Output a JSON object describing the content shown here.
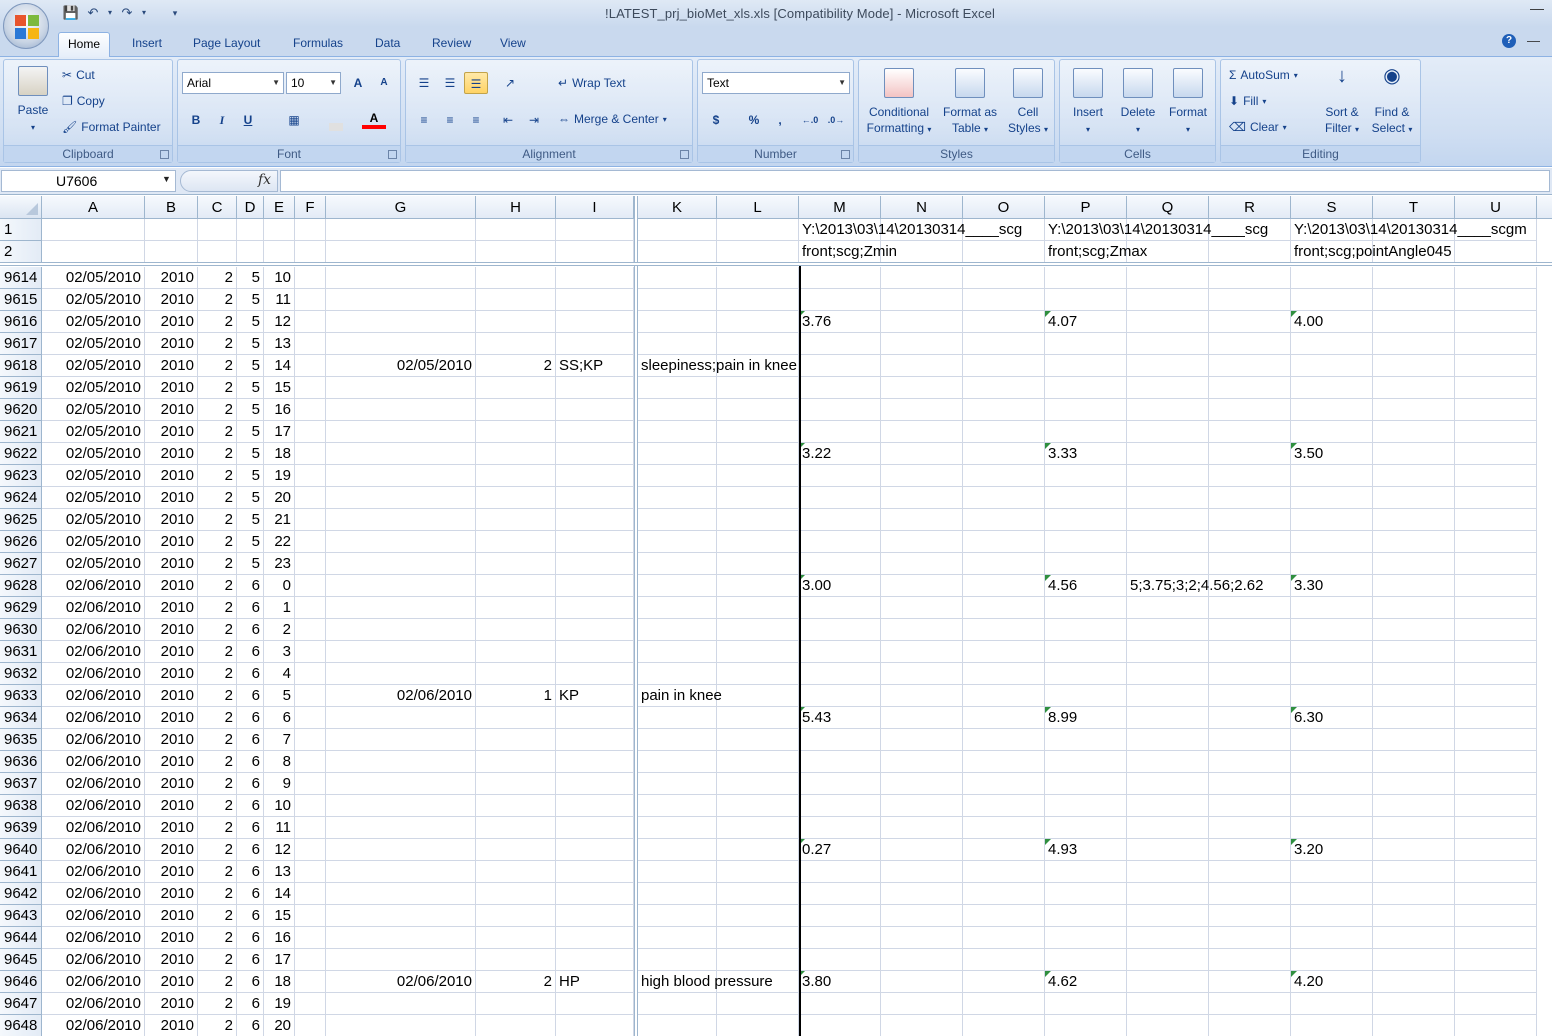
{
  "window": {
    "title": "!LATEST_prj_bioMet_xls.xls  [Compatibility Mode] - Microsoft Excel"
  },
  "tabs": [
    "Home",
    "Insert",
    "Page Layout",
    "Formulas",
    "Data",
    "Review",
    "View"
  ],
  "active_tab": "Home",
  "clipboard": {
    "paste": "Paste",
    "cut": "Cut",
    "copy": "Copy",
    "format_painter": "Format Painter",
    "label": "Clipboard"
  },
  "font": {
    "name": "Arial",
    "size": "10",
    "label": "Font",
    "bold": "B",
    "italic": "I",
    "underline": "U",
    "grow": "A",
    "shrink": "A",
    "font_color": "A",
    "fill_color": "#ffff00",
    "text_color": "#ff0000"
  },
  "alignment": {
    "wrap_text": "Wrap Text",
    "merge_center": "Merge & Center",
    "label": "Alignment"
  },
  "number": {
    "format": "Text",
    "currency": "$",
    "percent": "%",
    "comma": ",",
    "label": "Number"
  },
  "styles": {
    "conditional": "Conditional",
    "formatting": "Formatting",
    "format_as": "Format as",
    "table": "Table",
    "cell": "Cell",
    "cell_styles": "Styles",
    "label": "Styles"
  },
  "cells": {
    "insert": "Insert",
    "delete": "Delete",
    "format": "Format",
    "label": "Cells"
  },
  "editing": {
    "autosum": "AutoSum",
    "fill": "Fill",
    "clear": "Clear",
    "sort1": "Sort &",
    "sort2": "Filter",
    "find1": "Find &",
    "find2": "Select",
    "label": "Editing"
  },
  "formula_bar": {
    "name_box": "U7606",
    "fx": "fx",
    "formula": ""
  },
  "columns": [
    "A",
    "B",
    "C",
    "D",
    "E",
    "F",
    "G",
    "H",
    "I",
    "K",
    "L",
    "M",
    "N",
    "O",
    "P",
    "Q",
    "R",
    "S",
    "T",
    "U"
  ],
  "header_rows": [
    {
      "num": "1",
      "M": "Y:\\2013\\03\\14\\20130314____scg",
      "P": "Y:\\2013\\03\\14\\20130314____scg",
      "S": "Y:\\2013\\03\\14\\20130314____scgm"
    },
    {
      "num": "2",
      "M": "front;scg;Zmin",
      "P": "front;scg;Zmax",
      "S": "front;scg;pointAngle045"
    }
  ],
  "rows": [
    {
      "num": "9614",
      "A": "02/05/2010",
      "B": "2010",
      "C": "2",
      "D": "5",
      "E": "10"
    },
    {
      "num": "9615",
      "A": "02/05/2010",
      "B": "2010",
      "C": "2",
      "D": "5",
      "E": "11"
    },
    {
      "num": "9616",
      "A": "02/05/2010",
      "B": "2010",
      "C": "2",
      "D": "5",
      "E": "12",
      "M": "3.76",
      "P": "4.07",
      "S": "4.00"
    },
    {
      "num": "9617",
      "A": "02/05/2010",
      "B": "2010",
      "C": "2",
      "D": "5",
      "E": "13"
    },
    {
      "num": "9618",
      "A": "02/05/2010",
      "B": "2010",
      "C": "2",
      "D": "5",
      "E": "14",
      "G": "02/05/2010",
      "H": "2",
      "I": "SS;KP",
      "K": "sleepiness;pain in knee"
    },
    {
      "num": "9619",
      "A": "02/05/2010",
      "B": "2010",
      "C": "2",
      "D": "5",
      "E": "15"
    },
    {
      "num": "9620",
      "A": "02/05/2010",
      "B": "2010",
      "C": "2",
      "D": "5",
      "E": "16"
    },
    {
      "num": "9621",
      "A": "02/05/2010",
      "B": "2010",
      "C": "2",
      "D": "5",
      "E": "17"
    },
    {
      "num": "9622",
      "A": "02/05/2010",
      "B": "2010",
      "C": "2",
      "D": "5",
      "E": "18",
      "M": "3.22",
      "P": "3.33",
      "S": "3.50"
    },
    {
      "num": "9623",
      "A": "02/05/2010",
      "B": "2010",
      "C": "2",
      "D": "5",
      "E": "19"
    },
    {
      "num": "9624",
      "A": "02/05/2010",
      "B": "2010",
      "C": "2",
      "D": "5",
      "E": "20"
    },
    {
      "num": "9625",
      "A": "02/05/2010",
      "B": "2010",
      "C": "2",
      "D": "5",
      "E": "21"
    },
    {
      "num": "9626",
      "A": "02/05/2010",
      "B": "2010",
      "C": "2",
      "D": "5",
      "E": "22"
    },
    {
      "num": "9627",
      "A": "02/05/2010",
      "B": "2010",
      "C": "2",
      "D": "5",
      "E": "23"
    },
    {
      "num": "9628",
      "A": "02/06/2010",
      "B": "2010",
      "C": "2",
      "D": "6",
      "E": "0",
      "M": "3.00",
      "P": "4.56",
      "Q": "5;3.75;3;2;4.56;2.62",
      "S": "3.30"
    },
    {
      "num": "9629",
      "A": "02/06/2010",
      "B": "2010",
      "C": "2",
      "D": "6",
      "E": "1"
    },
    {
      "num": "9630",
      "A": "02/06/2010",
      "B": "2010",
      "C": "2",
      "D": "6",
      "E": "2"
    },
    {
      "num": "9631",
      "A": "02/06/2010",
      "B": "2010",
      "C": "2",
      "D": "6",
      "E": "3"
    },
    {
      "num": "9632",
      "A": "02/06/2010",
      "B": "2010",
      "C": "2",
      "D": "6",
      "E": "4"
    },
    {
      "num": "9633",
      "A": "02/06/2010",
      "B": "2010",
      "C": "2",
      "D": "6",
      "E": "5",
      "G": "02/06/2010",
      "H": "1",
      "I": "KP",
      "K": "pain in knee"
    },
    {
      "num": "9634",
      "A": "02/06/2010",
      "B": "2010",
      "C": "2",
      "D": "6",
      "E": "6",
      "M": "5.43",
      "P": "8.99",
      "S": "6.30"
    },
    {
      "num": "9635",
      "A": "02/06/2010",
      "B": "2010",
      "C": "2",
      "D": "6",
      "E": "7"
    },
    {
      "num": "9636",
      "A": "02/06/2010",
      "B": "2010",
      "C": "2",
      "D": "6",
      "E": "8"
    },
    {
      "num": "9637",
      "A": "02/06/2010",
      "B": "2010",
      "C": "2",
      "D": "6",
      "E": "9"
    },
    {
      "num": "9638",
      "A": "02/06/2010",
      "B": "2010",
      "C": "2",
      "D": "6",
      "E": "10"
    },
    {
      "num": "9639",
      "A": "02/06/2010",
      "B": "2010",
      "C": "2",
      "D": "6",
      "E": "11"
    },
    {
      "num": "9640",
      "A": "02/06/2010",
      "B": "2010",
      "C": "2",
      "D": "6",
      "E": "12",
      "M": "0.27",
      "P": "4.93",
      "S": "3.20"
    },
    {
      "num": "9641",
      "A": "02/06/2010",
      "B": "2010",
      "C": "2",
      "D": "6",
      "E": "13"
    },
    {
      "num": "9642",
      "A": "02/06/2010",
      "B": "2010",
      "C": "2",
      "D": "6",
      "E": "14"
    },
    {
      "num": "9643",
      "A": "02/06/2010",
      "B": "2010",
      "C": "2",
      "D": "6",
      "E": "15"
    },
    {
      "num": "9644",
      "A": "02/06/2010",
      "B": "2010",
      "C": "2",
      "D": "6",
      "E": "16"
    },
    {
      "num": "9645",
      "A": "02/06/2010",
      "B": "2010",
      "C": "2",
      "D": "6",
      "E": "17"
    },
    {
      "num": "9646",
      "A": "02/06/2010",
      "B": "2010",
      "C": "2",
      "D": "6",
      "E": "18",
      "G": "02/06/2010",
      "H": "2",
      "I": "HP",
      "K": "high blood pressure",
      "M": "3.80",
      "P": "4.62",
      "S": "4.20"
    },
    {
      "num": "9647",
      "A": "02/06/2010",
      "B": "2010",
      "C": "2",
      "D": "6",
      "E": "19"
    },
    {
      "num": "9648",
      "A": "02/06/2010",
      "B": "2010",
      "C": "2",
      "D": "6",
      "E": "20"
    }
  ]
}
